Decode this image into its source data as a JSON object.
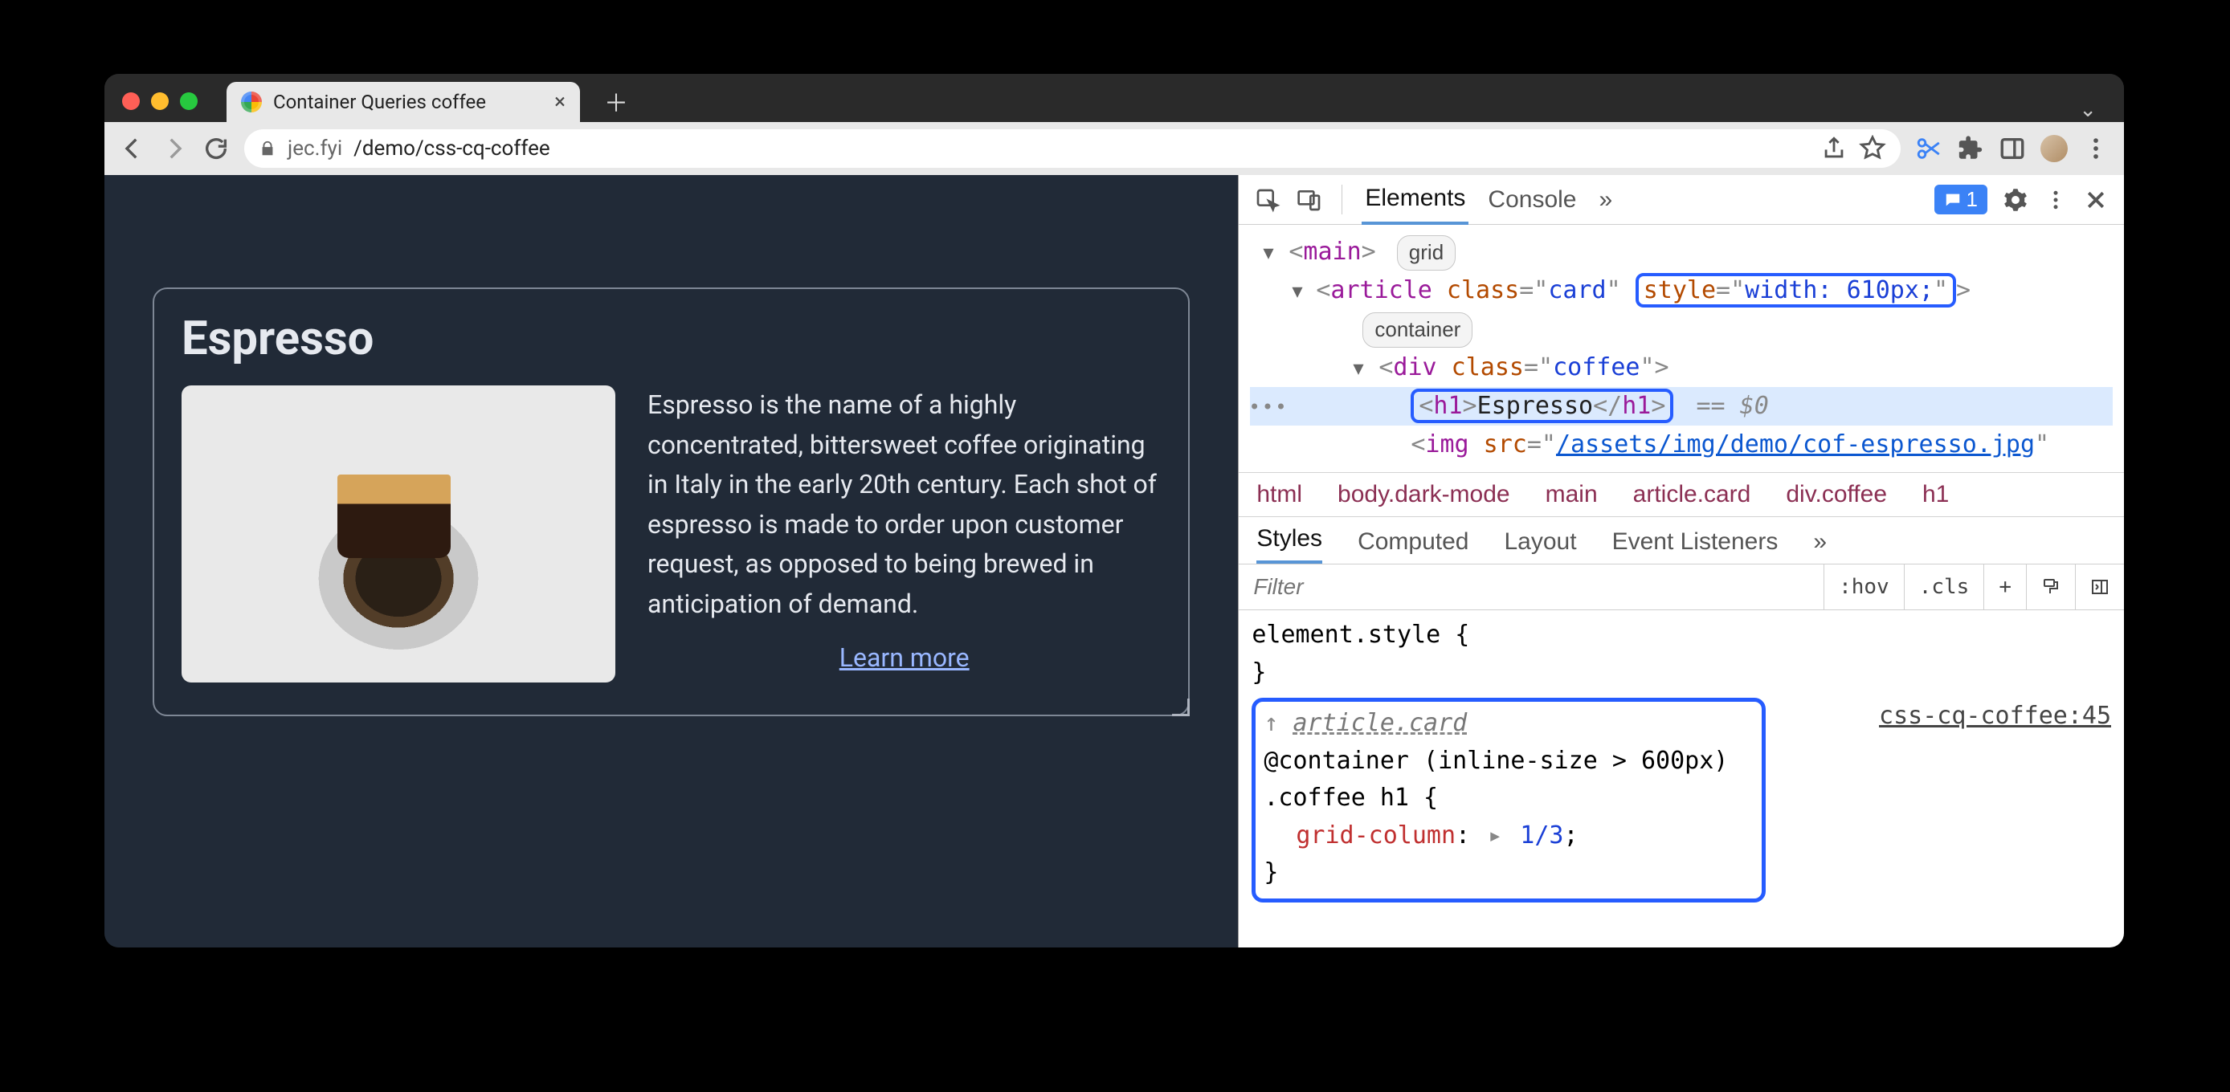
{
  "tab_title": "Container Queries coffee",
  "url_host": "jec.fyi",
  "url_path": "/demo/css-cq-coffee",
  "page": {
    "heading": "Espresso",
    "description": "Espresso is the name of a highly concentrated, bittersweet coffee originating in Italy in the early 20th century. Each shot of espresso is made to order upon customer request, as opposed to being brewed in anticipation of demand.",
    "learn_more": "Learn more"
  },
  "devtools": {
    "tabs": {
      "elements": "Elements",
      "console": "Console",
      "more": "»",
      "issue_count": "1"
    },
    "dom": {
      "main_badge": "grid",
      "article_class": "card",
      "article_style": "width: 610px;",
      "article_badge": "container",
      "div_class": "coffee",
      "h1_text": "Espresso",
      "selected_marker": "== $0",
      "img_src": "/assets/img/demo/cof-espresso.jpg"
    },
    "breadcrumbs": [
      "html",
      "body.dark-mode",
      "main",
      "article.card",
      "div.coffee",
      "h1"
    ],
    "subtabs": {
      "styles": "Styles",
      "computed": "Computed",
      "layout": "Layout",
      "listeners": "Event Listeners",
      "more": "»"
    },
    "filter_placeholder": "Filter",
    "controls": {
      "hov": ":hov",
      "cls": ".cls",
      "plus": "+"
    },
    "element_style": "element.style {",
    "close_brace": "}",
    "container_link": "article.card",
    "container_query": "@container (inline-size > 600px)",
    "selector": ".coffee h1 {",
    "property": "grid-column",
    "value": "1/3",
    "source": "css-cq-coffee:45"
  }
}
